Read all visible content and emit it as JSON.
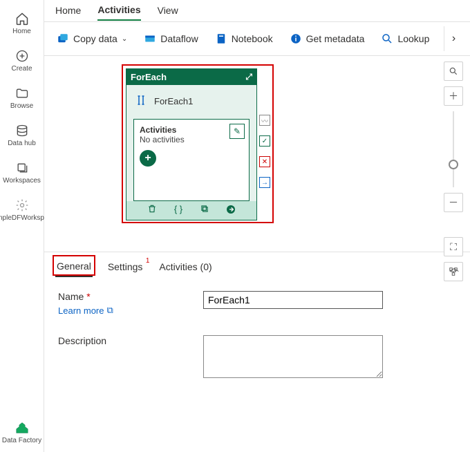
{
  "rail": {
    "items": [
      {
        "label": "Home",
        "icon": "home"
      },
      {
        "label": "Create",
        "icon": "plus-circle"
      },
      {
        "label": "Browse",
        "icon": "folder"
      },
      {
        "label": "Data hub",
        "icon": "database"
      },
      {
        "label": "Workspaces",
        "icon": "stack"
      },
      {
        "label": "SampleDFWorkspace",
        "icon": "gear"
      }
    ],
    "footer": {
      "label": "Data Factory",
      "icon": "factory"
    }
  },
  "tabs": {
    "home": "Home",
    "activities": "Activities",
    "view": "View"
  },
  "toolbar": {
    "copy": "Copy data",
    "dataflow": "Dataflow",
    "notebook": "Notebook",
    "getmeta": "Get metadata",
    "lookup": "Lookup"
  },
  "node": {
    "type": "ForEach",
    "name": "ForEach1",
    "activities_head": "Activities",
    "activities_sub": "No activities"
  },
  "panel": {
    "tabs": {
      "general": "General",
      "settings": "Settings",
      "settings_badge": "1",
      "activities": "Activities (0)"
    },
    "name_label": "Name",
    "learn": "Learn more",
    "desc_label": "Description",
    "name_value": "ForEach1",
    "desc_value": ""
  }
}
